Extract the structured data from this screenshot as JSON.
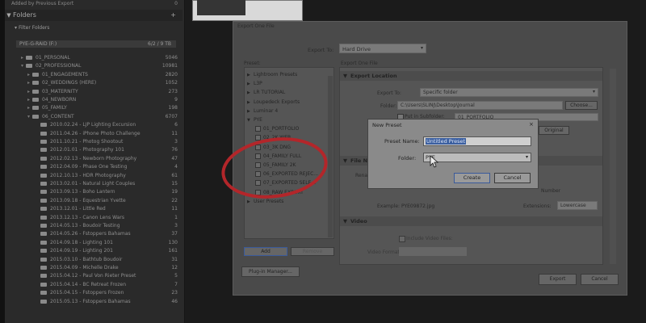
{
  "lr": {
    "added_label": "Added by Previous Export",
    "added_count": "0",
    "folders_title": "Folders",
    "filter_label": "Filter Folders",
    "volume": {
      "name": "PYE-G-RAID (F:)",
      "size": "6/2 / 9 TB"
    },
    "folders": [
      {
        "name": "01_PERSONAL",
        "count": "5046",
        "depth": 1,
        "expanded": false
      },
      {
        "name": "02_PROFESSIONAL",
        "count": "10981",
        "depth": 1,
        "expanded": true
      },
      {
        "name": "01_ENGAGEMENTS",
        "count": "2820",
        "depth": 2,
        "expanded": false
      },
      {
        "name": "02_WEDDINGS (HERE)",
        "count": "1052",
        "depth": 2,
        "expanded": false
      },
      {
        "name": "03_MATERNITY",
        "count": "273",
        "depth": 2,
        "expanded": false
      },
      {
        "name": "04_NEWBORN",
        "count": "9",
        "depth": 2,
        "expanded": false
      },
      {
        "name": "05_FAMILY",
        "count": "198",
        "depth": 2,
        "expanded": false
      },
      {
        "name": "06_CONTENT",
        "count": "6707",
        "depth": 2,
        "expanded": true
      },
      {
        "name": "2010.02.24 - LJP Lighting Excursion",
        "count": "6",
        "depth": 3
      },
      {
        "name": "2011.04.26 - iPhone Photo Challenge",
        "count": "11",
        "depth": 3
      },
      {
        "name": "2011.10.21 - Photog Shootout",
        "count": "3",
        "depth": 3
      },
      {
        "name": "2012.01.01 - Photography 101",
        "count": "76",
        "depth": 3
      },
      {
        "name": "2012.02.13 - Newborn Photography",
        "count": "47",
        "depth": 3
      },
      {
        "name": "2012.04.09 - Phase One Testing",
        "count": "4",
        "depth": 3
      },
      {
        "name": "2012.10.13 - HDR Photography",
        "count": "61",
        "depth": 3
      },
      {
        "name": "2013.02.01 - Natural Light Couples",
        "count": "15",
        "depth": 3
      },
      {
        "name": "2013.09.13 - Boho Lantern",
        "count": "19",
        "depth": 3
      },
      {
        "name": "2013.09.18 - Equestrian Yvette",
        "count": "22",
        "depth": 3
      },
      {
        "name": "2013.12.01 - Little Red",
        "count": "11",
        "depth": 3
      },
      {
        "name": "2013.12.13 - Canon Lens Wars",
        "count": "1",
        "depth": 3
      },
      {
        "name": "2014.05.13 - Boudoir Testing",
        "count": "3",
        "depth": 3
      },
      {
        "name": "2014.05.26 - Fstoppers Bahamas",
        "count": "37",
        "depth": 3
      },
      {
        "name": "2014.09.18 - Lighting 101",
        "count": "130",
        "depth": 3
      },
      {
        "name": "2014.09.19 - Lighting 201",
        "count": "161",
        "depth": 3
      },
      {
        "name": "2015.03.10 - Bathtub Boudoir",
        "count": "31",
        "depth": 3
      },
      {
        "name": "2015.04.09 - Michelle Drake",
        "count": "12",
        "depth": 3
      },
      {
        "name": "2015.04.12 - Paul Von Rieter Preset",
        "count": "5",
        "depth": 3
      },
      {
        "name": "2015.04.14 - BC Retreat Frozen",
        "count": "7",
        "depth": 3
      },
      {
        "name": "2015.04.15 - Fstoppers Frozen",
        "count": "23",
        "depth": 3
      },
      {
        "name": "2015.05.13 - Fstoppers Bahamas",
        "count": "46",
        "depth": 3
      }
    ]
  },
  "dialog": {
    "title": "Export One File",
    "export_to_label": "Export To:",
    "export_to_value": "Hard Drive",
    "preset_label": "Preset:",
    "right_header": "Export One File",
    "presets": [
      {
        "label": "Lightroom Presets",
        "kind": "group"
      },
      {
        "label": "L3P",
        "kind": "group"
      },
      {
        "label": "LR TUTORIAL",
        "kind": "group"
      },
      {
        "label": "Loupedeck Exports",
        "kind": "group"
      },
      {
        "label": "Luminar 4",
        "kind": "group"
      },
      {
        "label": "PYE",
        "kind": "group-open"
      },
      {
        "label": "01_PORTFOLIO",
        "kind": "item"
      },
      {
        "label": "02_2K WEB",
        "kind": "item"
      },
      {
        "label": "03_3K DNG",
        "kind": "item"
      },
      {
        "label": "04_FAMILY FULL",
        "kind": "item"
      },
      {
        "label": "05_FAMILY 2K",
        "kind": "item"
      },
      {
        "label": "06_EXPORTED REJEC...",
        "kind": "item"
      },
      {
        "label": "07_EXPORTED SELE...",
        "kind": "item"
      },
      {
        "label": "08_RAW EXPORT",
        "kind": "item"
      },
      {
        "label": "User Presets",
        "kind": "group"
      }
    ],
    "add_label": "Add",
    "remove_label": "Remove",
    "plugin_label": "Plug-in Manager...",
    "export_label": "Export",
    "cancel_label": "Cancel",
    "sections": {
      "export_location": "Export Location",
      "file_naming": "File Na",
      "video": "Video"
    },
    "export_to2_label": "Export To:",
    "export_to2_value": "Specific folder",
    "folder_label": "Folder:",
    "folder_value": "C:\\Users\\SLINJ\\Desktop\\Journal",
    "choose_label": "Choose...",
    "subfolder_label": "Put in Subfolder:",
    "subfolder_value": "01_PORTFOLIO",
    "original_label": "Original",
    "rename_label": "Rena",
    "example_label": "Example: PYE09872.jpg",
    "extensions_label": "Extensions:",
    "extensions_value": "Lowercase",
    "number_label": "Number",
    "include_video_label": "Include Video Files:",
    "video_format_label": "Video Format:"
  },
  "new_preset": {
    "title": "New Preset",
    "close": "×",
    "name_label": "Preset Name:",
    "name_value": "Untitled Preset",
    "folder_label": "Folder:",
    "folder_value": "PYE",
    "create_label": "Create",
    "cancel_label": "Cancel"
  },
  "colors": {
    "annotation": "#b3262a",
    "selection": "#3b5fa0"
  }
}
